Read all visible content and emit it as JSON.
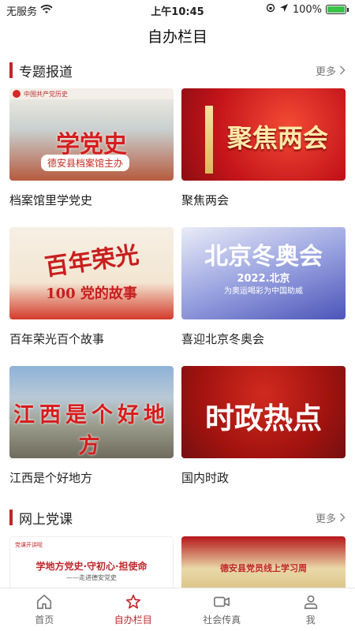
{
  "status": {
    "carrier": "无服务",
    "time": "上午10:45",
    "battery": "100%"
  },
  "nav": {
    "title": "自办栏目"
  },
  "sections": [
    {
      "title": "专题报道",
      "more": "更多"
    },
    {
      "title": "网上党课",
      "more": "更多"
    }
  ],
  "cards": [
    {
      "label": "档案馆里学党史",
      "overlay": "学党史",
      "sub": "德安县档案馆主办",
      "tag": "中国共产党历史"
    },
    {
      "label": "聚焦两会",
      "overlay": "聚焦两会"
    },
    {
      "label": "百年荣光百个故事",
      "overlay": "百年荣光",
      "sub": "100 党的故事"
    },
    {
      "label": "喜迎北京冬奥会",
      "overlay": "北京冬奥会",
      "sub": "2022.北京",
      "sub2": "为奥运喝彩为中国助威"
    },
    {
      "label": "江西是个好地方",
      "overlay": "江西是个好地方"
    },
    {
      "label": "国内时政",
      "overlay": "时政热点"
    }
  ],
  "course_cards": [
    {
      "overlay": "学地方党史·守初心·担使命",
      "sub": "——走进德安党史",
      "tag": "党课开讲啦"
    },
    {
      "overlay": "德安县党员线上学习周"
    }
  ],
  "tabs": [
    {
      "label": "首页",
      "icon": "home-icon"
    },
    {
      "label": "自办栏目",
      "icon": "star-icon",
      "active": true
    },
    {
      "label": "社会传真",
      "icon": "video-icon"
    },
    {
      "label": "我",
      "icon": "user-icon"
    }
  ]
}
